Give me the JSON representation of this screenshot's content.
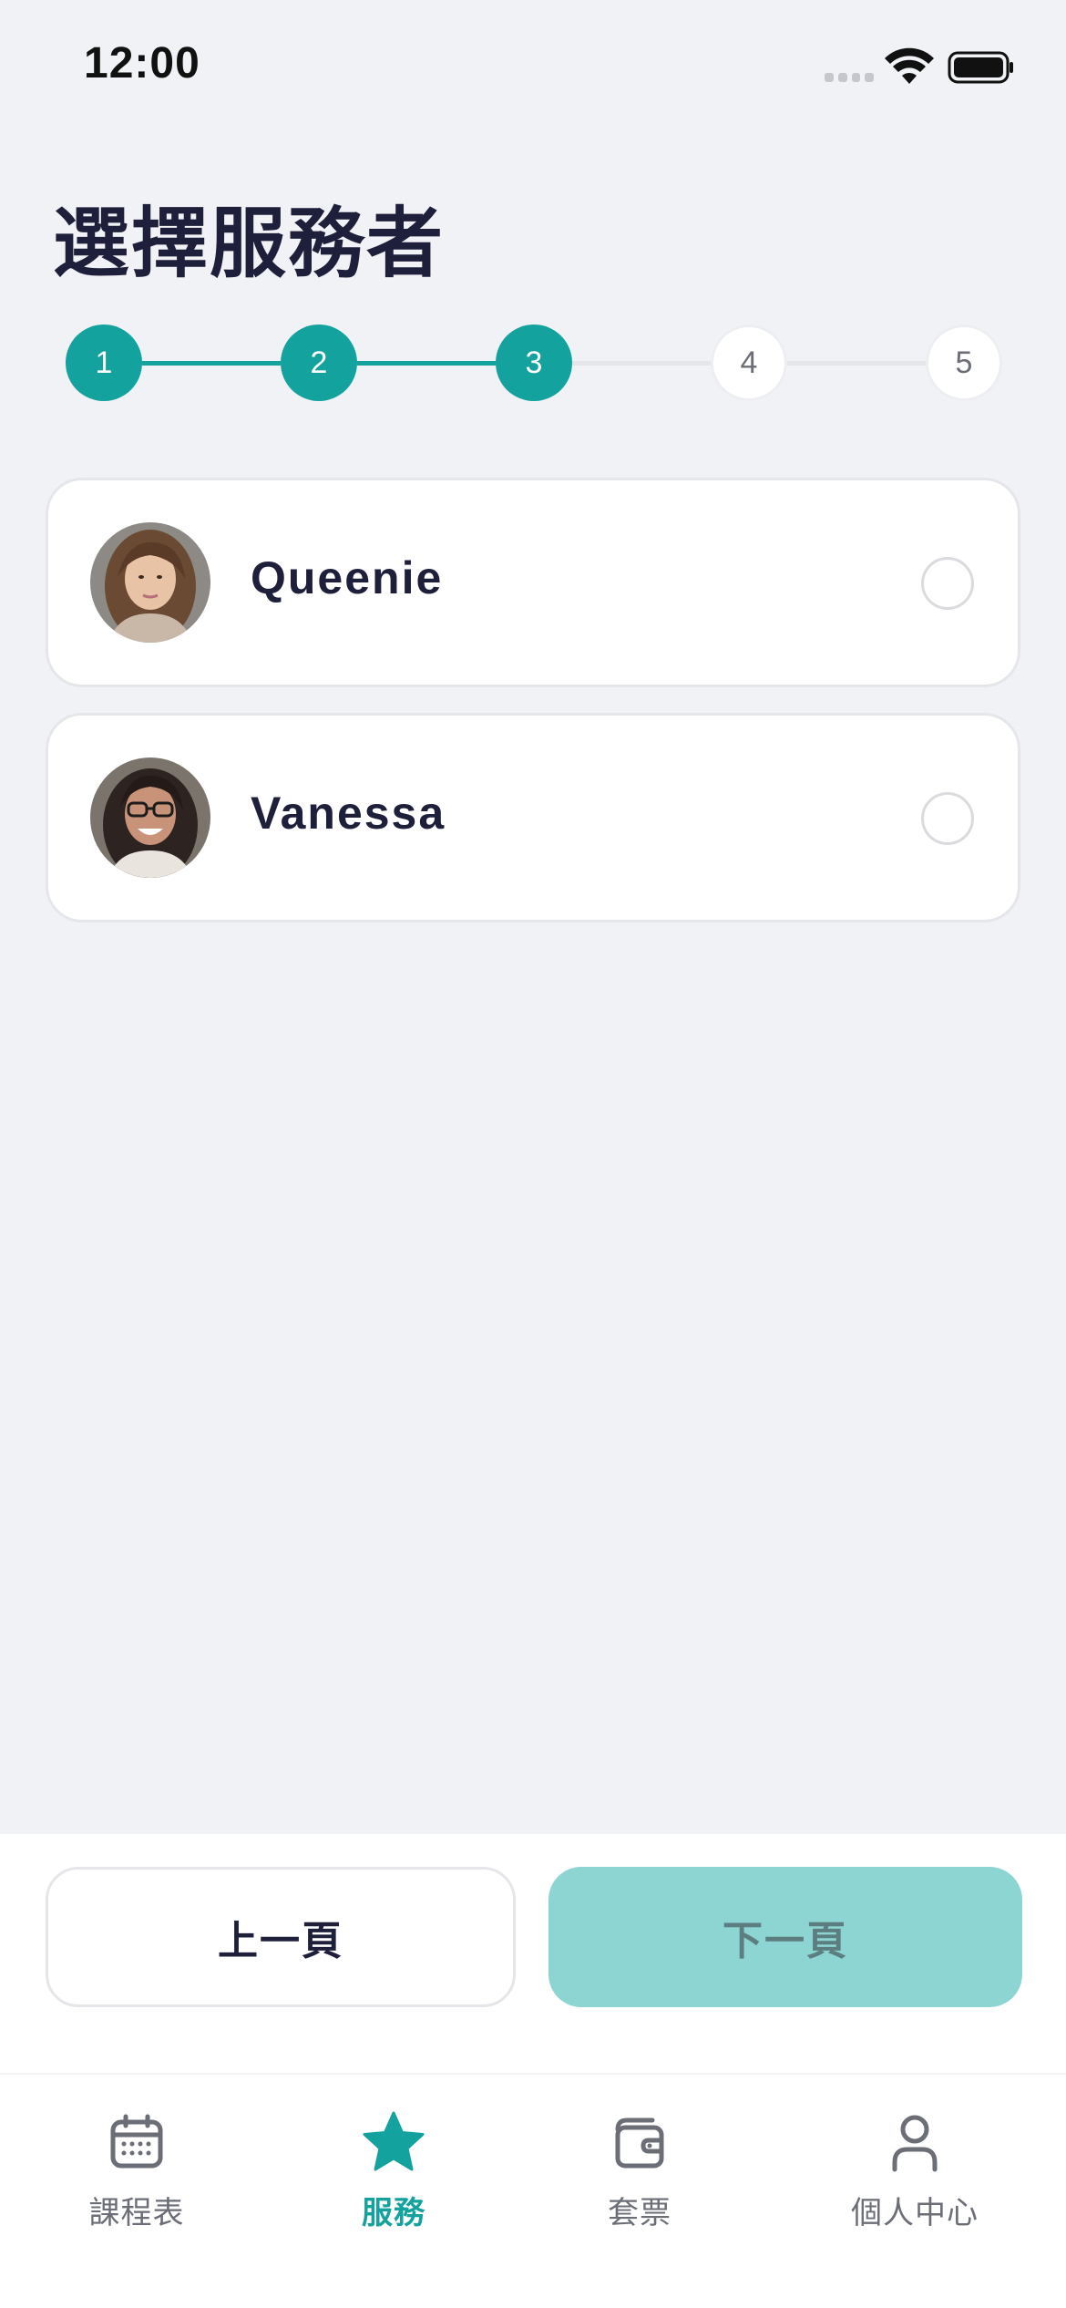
{
  "status_bar": {
    "time": "12:00"
  },
  "page": {
    "title": "選擇服務者"
  },
  "stepper": {
    "steps": [
      {
        "label": "1",
        "state": "active"
      },
      {
        "label": "2",
        "state": "active"
      },
      {
        "label": "3",
        "state": "active"
      },
      {
        "label": "4",
        "state": "pending"
      },
      {
        "label": "5",
        "state": "pending"
      }
    ],
    "current_step": 3
  },
  "providers": [
    {
      "name": "Queenie",
      "selected": false,
      "avatar_icon": "avatar-photo"
    },
    {
      "name": "Vanessa",
      "selected": false,
      "avatar_icon": "avatar-photo"
    }
  ],
  "actions": {
    "prev_label": "上一頁",
    "next_label": "下一頁",
    "next_enabled": false
  },
  "tab_bar": {
    "tabs": [
      {
        "label": "課程表",
        "icon": "calendar-icon",
        "active": false
      },
      {
        "label": "服務",
        "icon": "star-icon",
        "active": true
      },
      {
        "label": "套票",
        "icon": "wallet-icon",
        "active": false
      },
      {
        "label": "個人中心",
        "icon": "user-icon",
        "active": false
      }
    ]
  },
  "colors": {
    "accent": "#13a29d",
    "accent_disabled": "#8dd5d3",
    "background": "#f0f2f5",
    "text_primary": "#1e1f3a",
    "text_secondary": "#6b6e76"
  }
}
